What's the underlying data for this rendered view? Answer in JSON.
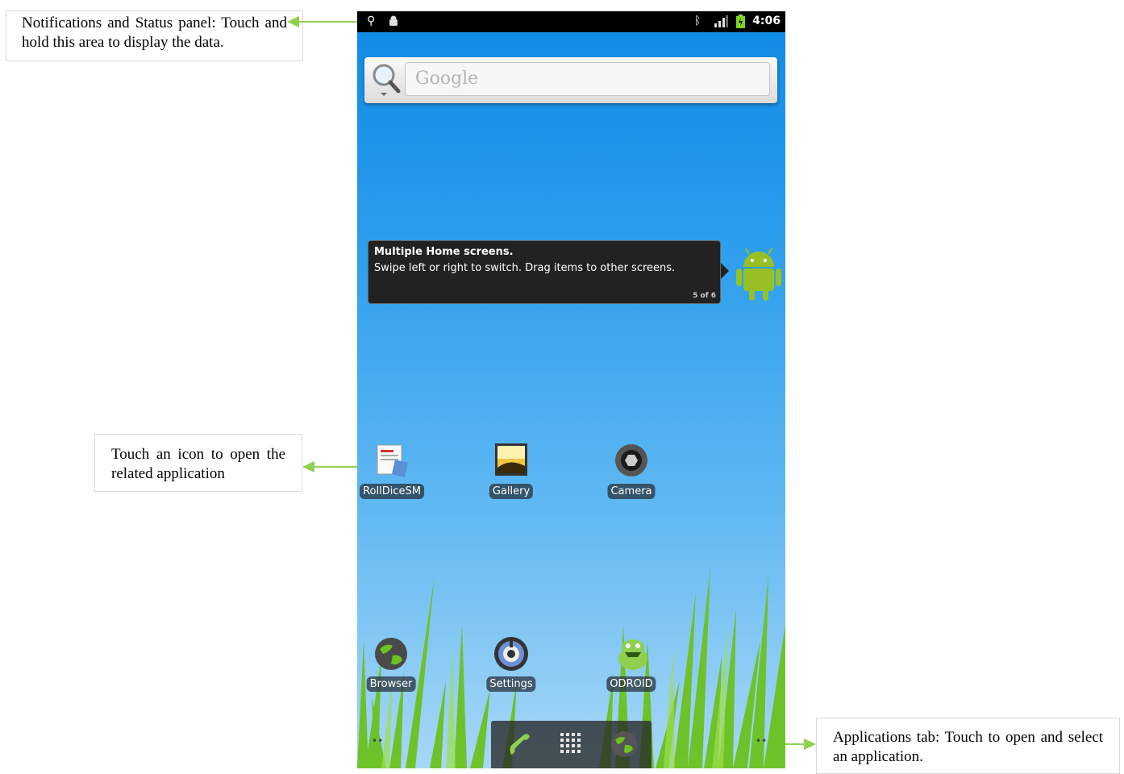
{
  "annotations": {
    "status_panel": "Notifications and Status panel: Touch and hold this area to display the data.",
    "icon_hint": "Touch an icon to open the related application",
    "apps_tab": "Applications tab: Touch to open and select an application."
  },
  "status_bar": {
    "time": "4:06",
    "icons": [
      "usb-icon",
      "android-debug-icon",
      "bluetooth-icon",
      "signal-icon",
      "battery-icon"
    ]
  },
  "search": {
    "placeholder": "Google"
  },
  "tooltip": {
    "title": "Multiple Home screens.",
    "body": "Swipe left or right to switch. Drag items to other screens.",
    "counter": "5 of 6"
  },
  "apps": {
    "row1": [
      {
        "label": "RollDiceSM",
        "icon": "rolldice-icon"
      },
      {
        "label": "Gallery",
        "icon": "gallery-icon"
      },
      {
        "label": "Camera",
        "icon": "camera-icon"
      }
    ],
    "row2": [
      {
        "label": "Browser",
        "icon": "browser-icon"
      },
      {
        "label": "Settings",
        "icon": "settings-icon"
      },
      {
        "label": "ODROID",
        "icon": "odroid-icon"
      }
    ]
  },
  "dock": {
    "items": [
      "phone-icon",
      "app-drawer-icon",
      "browser-icon"
    ]
  },
  "colors": {
    "connector": "#8fd14f",
    "status_bar": "#000000",
    "sky_top": "#0f8ae6",
    "grass": "#6cc21f"
  }
}
